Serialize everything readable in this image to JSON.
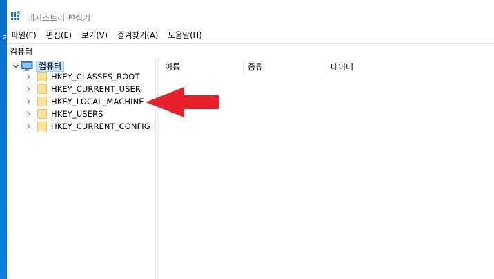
{
  "window": {
    "title": "레지스트리 편집기"
  },
  "menu": [
    {
      "label": "파일(F)"
    },
    {
      "label": "편집(E)"
    },
    {
      "label": "보기(V)"
    },
    {
      "label": "즐겨찾기(A)"
    },
    {
      "label": "도움말(H)"
    }
  ],
  "address": {
    "path": "컴퓨터"
  },
  "tree": {
    "root": {
      "label": "컴퓨터",
      "icon": "computer-icon",
      "expanded": true,
      "selected": true
    },
    "children": [
      {
        "label": "HKEY_CLASSES_ROOT",
        "icon": "folder-icon"
      },
      {
        "label": "HKEY_CURRENT_USER",
        "icon": "folder-icon"
      },
      {
        "label": "HKEY_LOCAL_MACHINE",
        "icon": "folder-icon"
      },
      {
        "label": "HKEY_USERS",
        "icon": "folder-icon"
      },
      {
        "label": "HKEY_CURRENT_CONFIG",
        "icon": "folder-icon"
      }
    ]
  },
  "list": {
    "columns": [
      {
        "label": "이름"
      },
      {
        "label": "종류"
      },
      {
        "label": "데이터"
      }
    ]
  },
  "annotation": {
    "arrow_color": "#e8202a",
    "points_to": "HKEY_LOCAL_MACHINE"
  },
  "colors": {
    "desktop": "#0a78d7",
    "selection": "#cce4f7",
    "folder": "#fbe29a"
  }
}
